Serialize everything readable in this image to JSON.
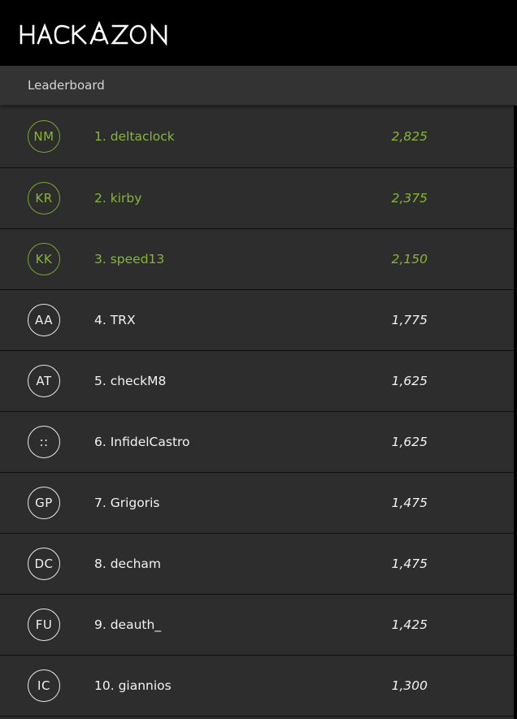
{
  "app": {
    "logo_text": "HACKAZON"
  },
  "section": {
    "title": "Leaderboard"
  },
  "colors": {
    "top_accent": "#86b82e",
    "row_bg": "#2d2d2d",
    "header_bg": "#000000"
  },
  "leaderboard": [
    {
      "initials": "NM",
      "name": "1. deltaclock",
      "score": "2,825",
      "top": true
    },
    {
      "initials": "KR",
      "name": "2. kirby",
      "score": "2,375",
      "top": true
    },
    {
      "initials": "KK",
      "name": "3. speed13",
      "score": "2,150",
      "top": true
    },
    {
      "initials": "AA",
      "name": "4. TRX",
      "score": "1,775",
      "top": false
    },
    {
      "initials": "AT",
      "name": "5. checkM8",
      "score": "1,625",
      "top": false
    },
    {
      "initials": "::",
      "name": "6. InfidelCastro",
      "score": "1,625",
      "top": false
    },
    {
      "initials": "GP",
      "name": "7. Grigoris",
      "score": "1,475",
      "top": false
    },
    {
      "initials": "DC",
      "name": "8. decham",
      "score": "1,475",
      "top": false
    },
    {
      "initials": "FU",
      "name": "9. deauth_",
      "score": "1,425",
      "top": false
    },
    {
      "initials": "IC",
      "name": "10. giannios",
      "score": "1,300",
      "top": false
    }
  ]
}
